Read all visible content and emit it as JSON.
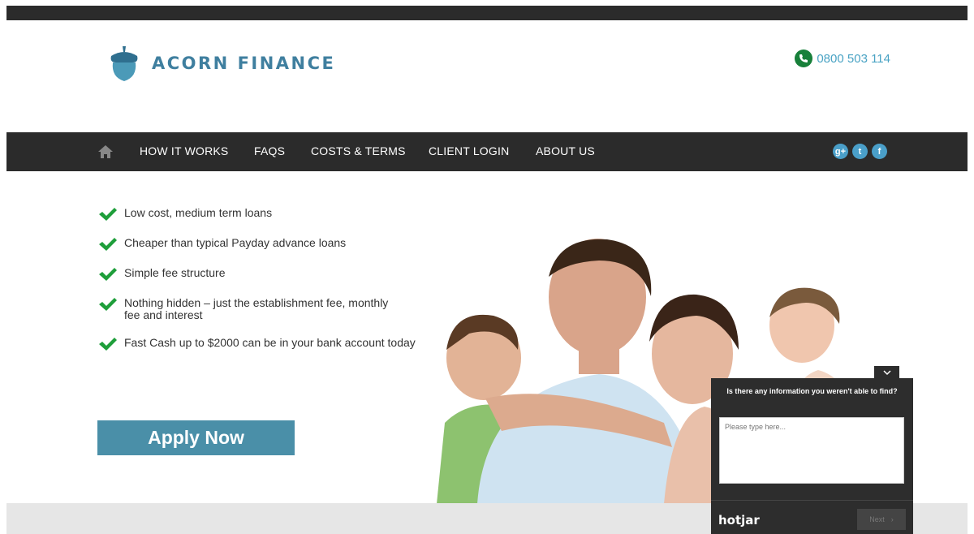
{
  "brand": {
    "name": "ACORN FINANCE"
  },
  "phone": {
    "number": "0800 503 114"
  },
  "nav": {
    "items": [
      {
        "label": "HOW IT WORKS"
      },
      {
        "label": "FAQS"
      },
      {
        "label": "COSTS & TERMS"
      },
      {
        "label": "CLIENT LOGIN"
      },
      {
        "label": "ABOUT US"
      }
    ],
    "social": [
      "g+",
      "t",
      "f"
    ]
  },
  "hero": {
    "bullets": [
      "Low cost, medium term loans",
      "Cheaper than typical Payday advance loans",
      "Simple fee structure",
      "Nothing hidden – just the establishment fee, monthly fee and interest",
      "Fast Cash up to $2000 can be in your bank account today"
    ],
    "apply_label": "Apply Now"
  },
  "feedback": {
    "question": "Is there any information you weren't able to find?",
    "placeholder": "Please type here...",
    "logo": "hotjar",
    "next_label": "Next"
  },
  "colors": {
    "accent": "#4a8fa8",
    "nav_bg": "#2b2b2b",
    "check": "#1e9e3a"
  }
}
